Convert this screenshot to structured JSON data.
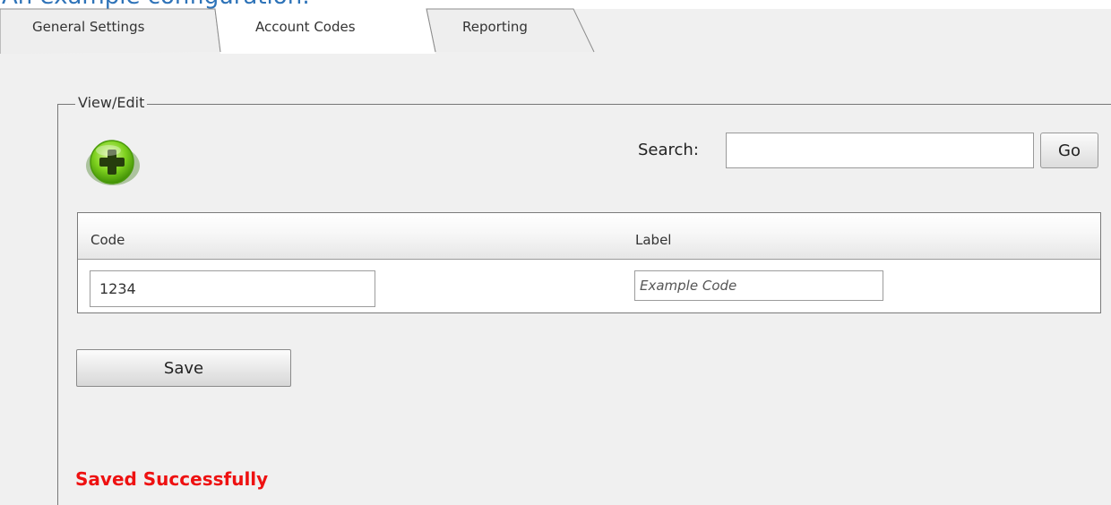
{
  "page": {
    "heading": "An example configuration:"
  },
  "tabs": [
    {
      "label": "General Settings",
      "active": false
    },
    {
      "label": "Account Codes",
      "active": true
    },
    {
      "label": "Reporting",
      "active": false
    }
  ],
  "view_edit": {
    "legend": "View/Edit",
    "add_icon": "plus-circle-icon",
    "search": {
      "label": "Search:",
      "value": "",
      "placeholder": "",
      "go_label": "Go"
    },
    "table": {
      "columns": [
        "Code",
        "Label"
      ],
      "rows": [
        {
          "code": "1234",
          "label_value": "",
          "label_placeholder": "Example Code"
        }
      ]
    },
    "save_label": "Save",
    "status_message": "Saved Successfully"
  },
  "colors": {
    "heading": "#2e73b8",
    "status": "#ee1111",
    "add_icon_green": "#6cc61a",
    "background": "#f0f0f0"
  }
}
